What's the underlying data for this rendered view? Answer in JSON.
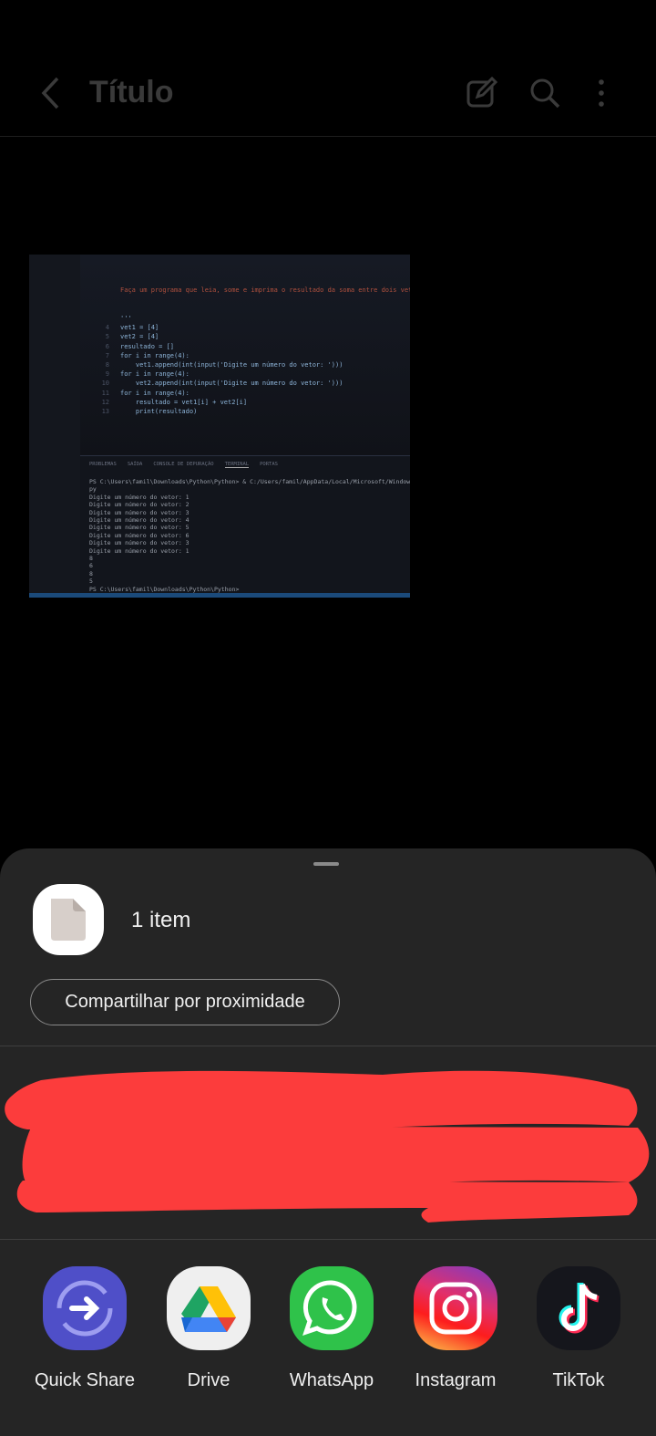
{
  "header": {
    "title": "Título",
    "back_icon": "chevron-left-icon",
    "edit_icon": "edit-icon",
    "search_icon": "search-icon",
    "more_icon": "more-vert-icon"
  },
  "photo": {
    "code_comment": "Faça um programa que leia, some e imprima o resultado da soma entre dois vetores",
    "code_lines": [
      {
        "n": "",
        "t": "'''"
      },
      {
        "n": "4",
        "t": "vet1 = [4]"
      },
      {
        "n": "5",
        "t": "vet2 = [4]"
      },
      {
        "n": "6",
        "t": "resultado = []"
      },
      {
        "n": "7",
        "t": "for i in range(4):"
      },
      {
        "n": "8",
        "t": "    vet1.append(int(input('Digite um número do vetor: ')))"
      },
      {
        "n": "9",
        "t": "for i in range(4):"
      },
      {
        "n": "10",
        "t": "    vet2.append(int(input('Digite um número do vetor: ')))"
      },
      {
        "n": "11",
        "t": "for i in range(4):"
      },
      {
        "n": "12",
        "t": "    resultado = vet1[i] + vet2[i]"
      },
      {
        "n": "13",
        "t": "    print(resultado)"
      }
    ],
    "panel_tabs": [
      "PROBLEMAS",
      "SAÍDA",
      "CONSOLE DE DEPURAÇÃO",
      "TERMINAL",
      "PORTAS"
    ],
    "terminal": "PS C:\\Users\\famil\\Downloads\\Python\\Python> & C:/Users/famil/AppData/Local/Microsoft/WindowsApps\npy\nDigite um número do vetor: 1\nDigite um número do vetor: 2\nDigite um número do vetor: 3\nDigite um número do vetor: 4\nDigite um número do vetor: 5\nDigite um número do vetor: 6\nDigite um número do vetor: 3\nDigite um número do vetor: 1\n8\n6\n8\n5\nPS C:\\Users\\famil\\Downloads\\Python\\Python> "
  },
  "sheet": {
    "item_count": "1 item",
    "file_icon": "file-icon",
    "nearby_label": "Compartilhar por proximidade",
    "redaction_color": "#fc3c3c",
    "apps": [
      {
        "label": "Quick Share",
        "icon": "quick-share-icon",
        "color": "#4f4fc8"
      },
      {
        "label": "Drive",
        "icon": "google-drive-icon",
        "color": "#efefef"
      },
      {
        "label": "WhatsApp",
        "icon": "whatsapp-icon",
        "color": "#2fc24a"
      },
      {
        "label": "Instagram",
        "icon": "instagram-icon",
        "color": "#e1306c"
      },
      {
        "label": "TikTok",
        "icon": "tiktok-icon",
        "color": "#15161c"
      }
    ]
  }
}
